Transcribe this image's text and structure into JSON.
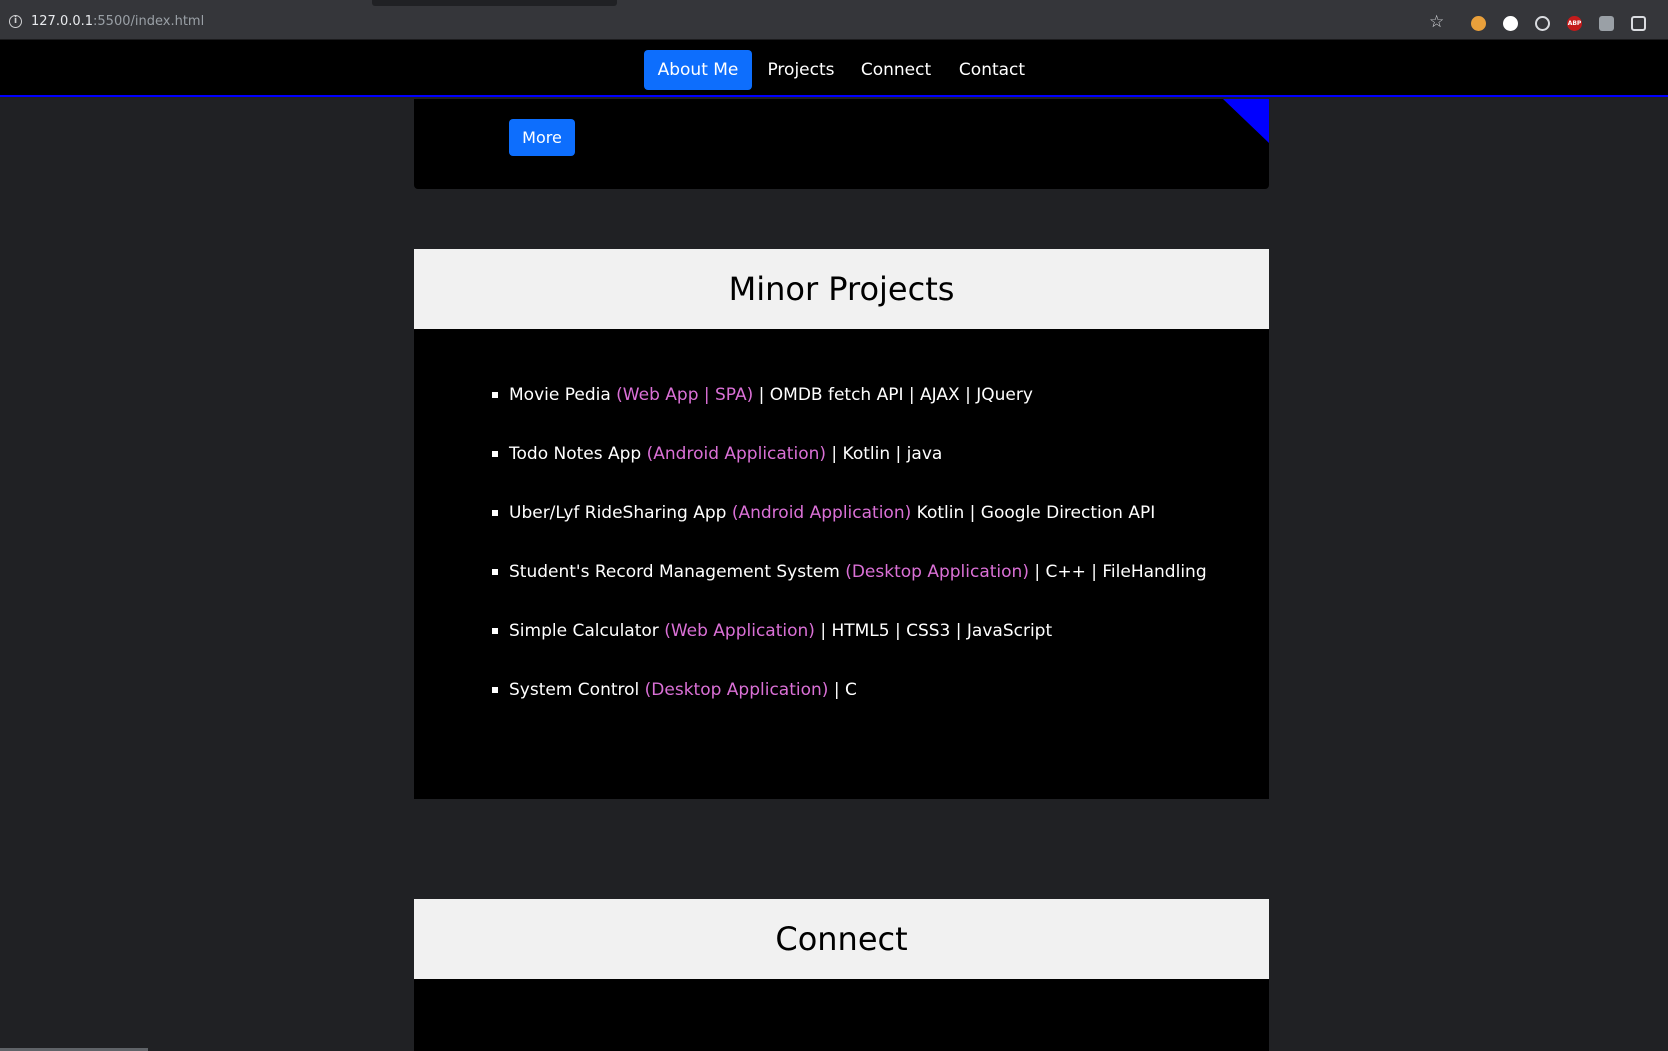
{
  "browser": {
    "url_host": "127.0.0.1",
    "url_rest": ":5500/index.html"
  },
  "nav": {
    "items": [
      {
        "label": "About Me",
        "active": true
      },
      {
        "label": "Projects",
        "active": false
      },
      {
        "label": "Connect",
        "active": false
      },
      {
        "label": "Contact",
        "active": false
      }
    ]
  },
  "previous_card": {
    "button_label": "More"
  },
  "minor_projects": {
    "title": "Minor Projects",
    "items": [
      {
        "name": "Movie Pedia",
        "tag": "(Web App | SPA)",
        "tech": "| OMDB fetch API | AJAX | JQuery"
      },
      {
        "name": "Todo Notes App",
        "tag": "(Android Application)",
        "tech": "| Kotlin | java"
      },
      {
        "name": "Uber/Lyf RideSharing App",
        "tag": "(Android Application)",
        "tech": "Kotlin | Google Direction API"
      },
      {
        "name": "Student's Record Management System",
        "tag": "(Desktop Application)",
        "tech": "| C++ | FileHandling"
      },
      {
        "name": "Simple Calculator",
        "tag": "(Web Application)",
        "tech": "| HTML5 | CSS3 | JavaScript"
      },
      {
        "name": "System Control",
        "tag": "(Desktop Application)",
        "tech": "| C"
      }
    ]
  },
  "connect": {
    "title": "Connect"
  },
  "colors": {
    "accent": "#0d6efd",
    "nav_border": "#0000ff",
    "tag": "#da70d6",
    "page_bg": "#202124"
  }
}
